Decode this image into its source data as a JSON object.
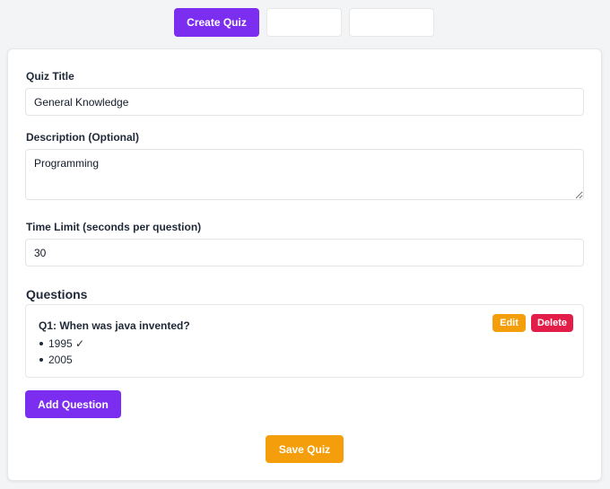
{
  "tabs": [
    {
      "label": "Create Quiz",
      "active": true
    },
    {
      "label": ""
    },
    {
      "label": ""
    }
  ],
  "form": {
    "title_label": "Quiz Title",
    "title_value": "General Knowledge",
    "description_label": "Description (Optional)",
    "description_value": "Programming",
    "time_label": "Time Limit (seconds per question)",
    "time_value": "30"
  },
  "questions": {
    "heading": "Questions",
    "items": [
      {
        "text": "Q1: When was java invented?",
        "options": [
          "1995 ✓",
          "2005"
        ],
        "edit_label": "Edit",
        "delete_label": "Delete"
      }
    ]
  },
  "actions": {
    "add_question_label": "Add Question",
    "save_label": "Save Quiz"
  },
  "colors": {
    "primary": "#7c2ef0",
    "warning": "#f59e0b",
    "danger": "#e11d48"
  }
}
